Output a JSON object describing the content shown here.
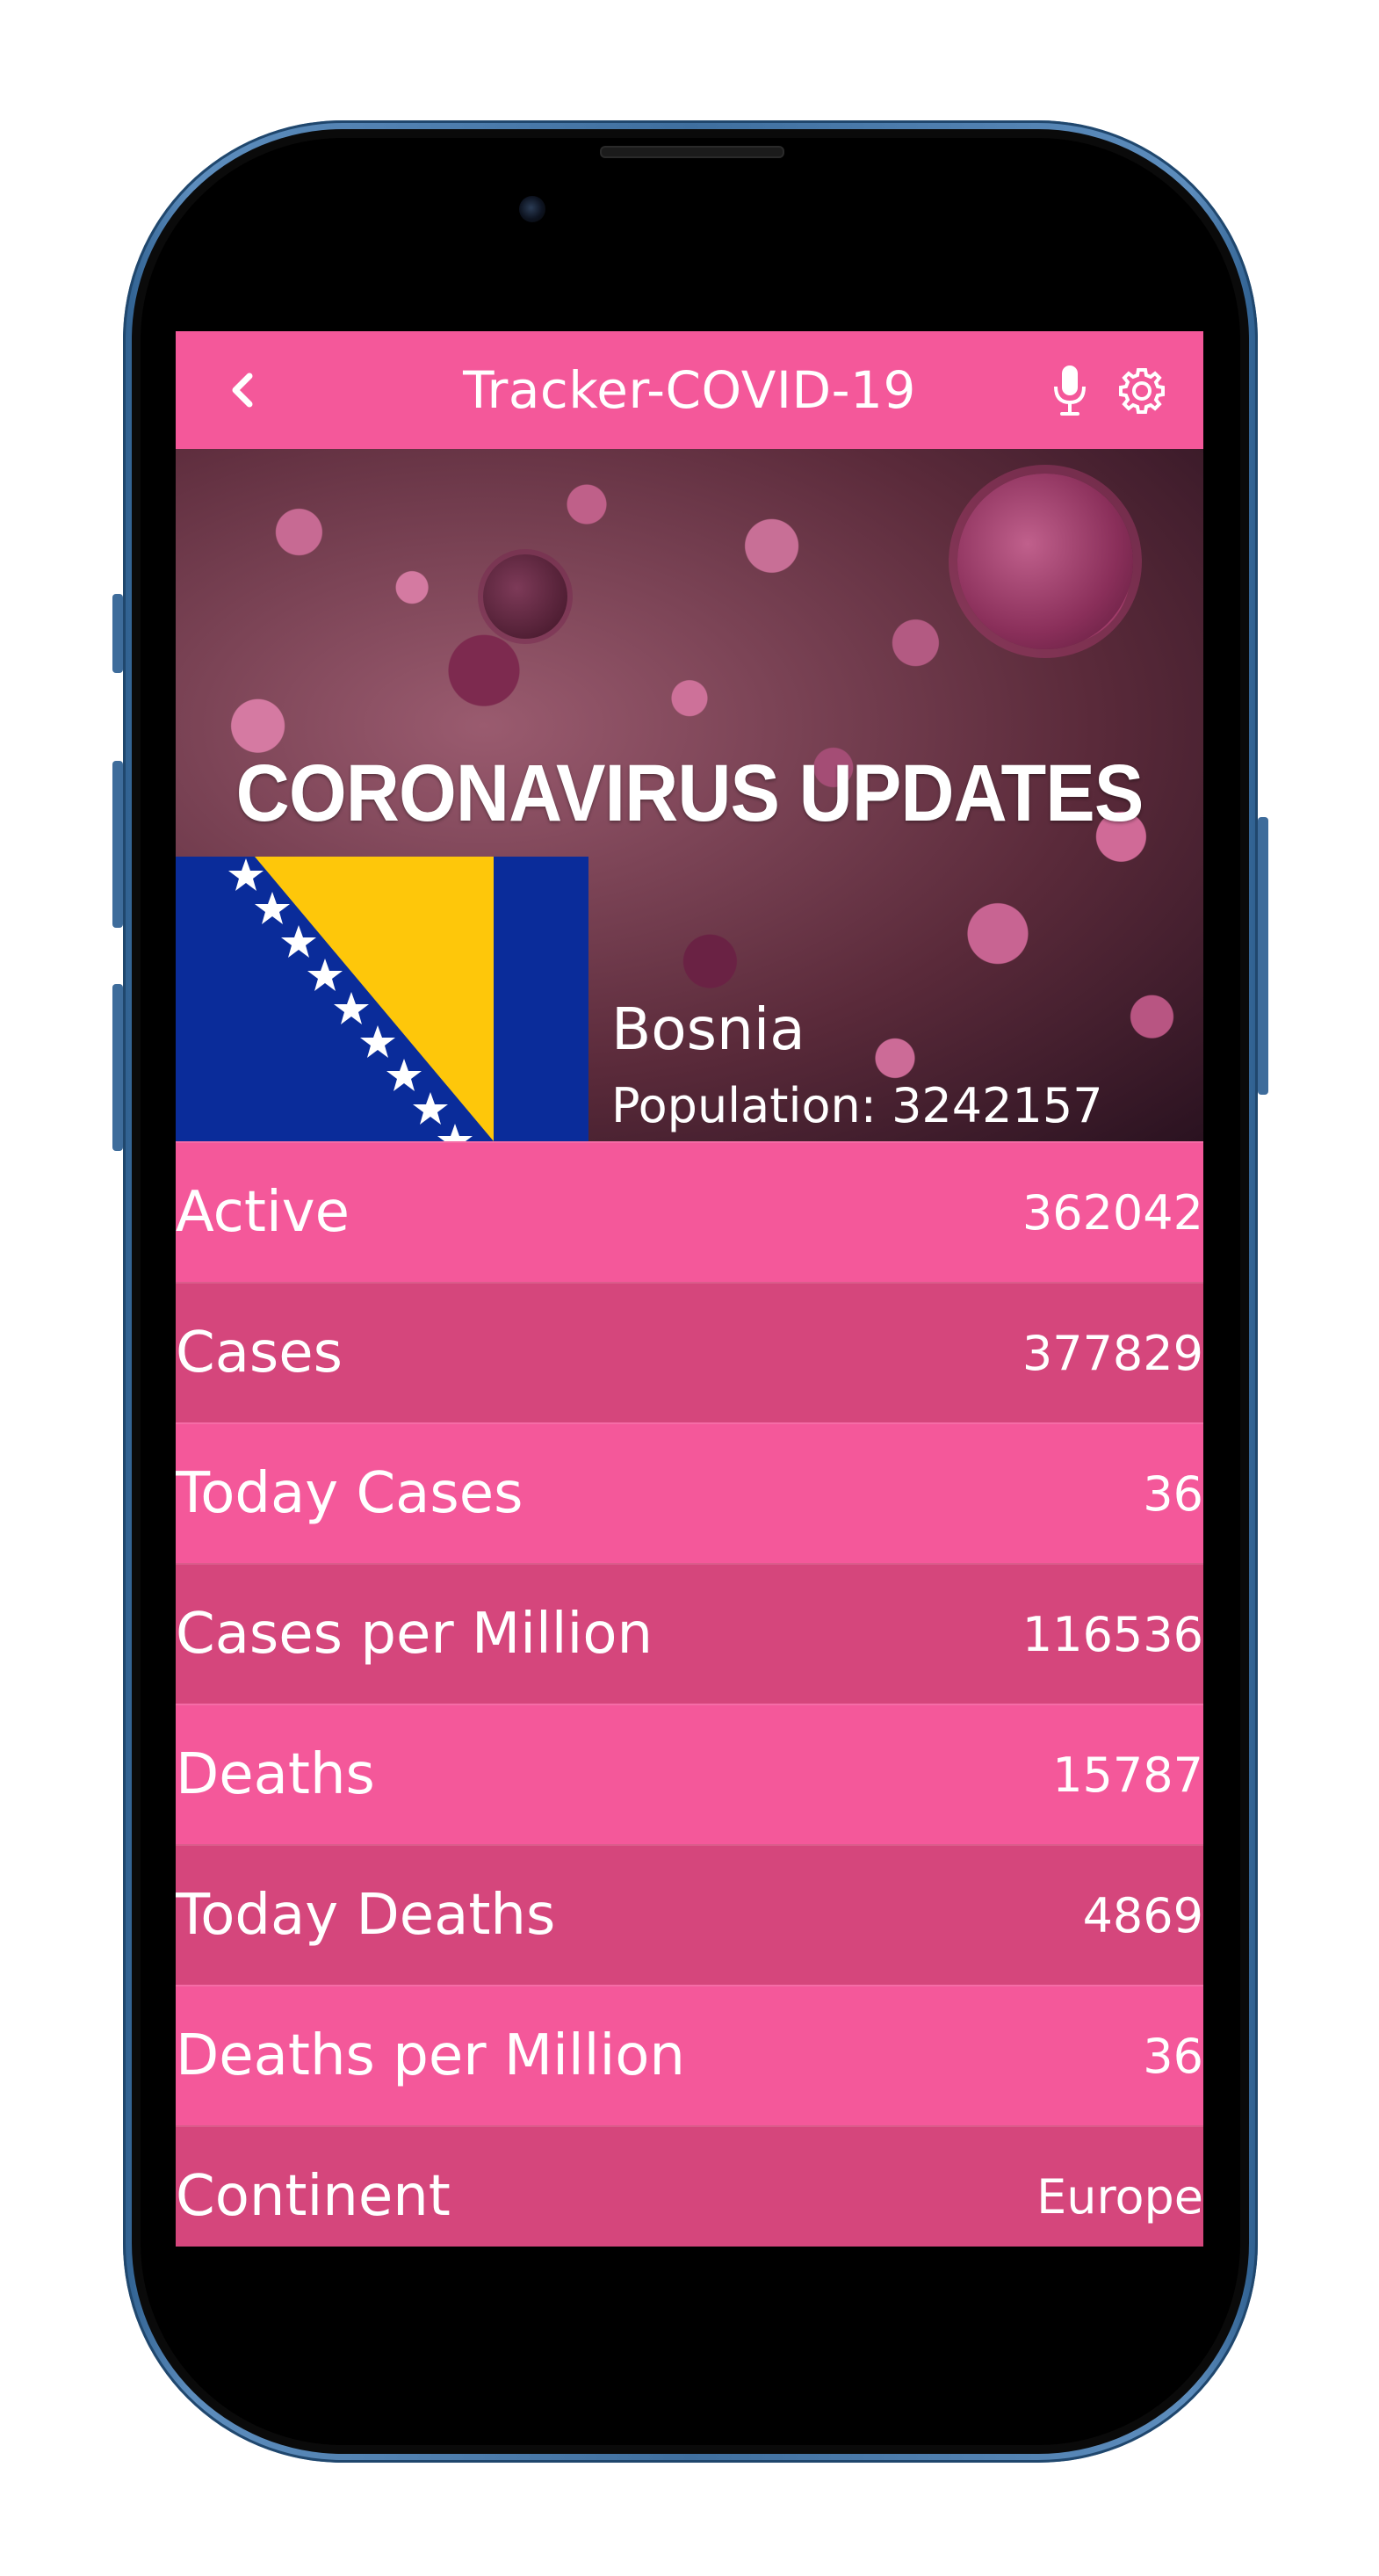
{
  "app": {
    "title": "Tracker-COVID-19"
  },
  "banner": {
    "heading": "CORONAVIRUS UPDATES",
    "country": "Bosnia",
    "population_text": "Population: 3242157"
  },
  "stats": [
    {
      "label": "Active",
      "value": "362042"
    },
    {
      "label": "Cases",
      "value": "377829"
    },
    {
      "label": "Today Cases",
      "value": "36"
    },
    {
      "label": "Cases per Million",
      "value": "116536"
    },
    {
      "label": "Deaths",
      "value": "15787"
    },
    {
      "label": "Today Deaths",
      "value": "4869"
    },
    {
      "label": "Deaths per Million",
      "value": "36"
    },
    {
      "label": "Continent",
      "value": "Europe"
    }
  ],
  "icons": {
    "back": "chevron-left-icon",
    "mic": "microphone-icon",
    "settings": "gear-icon"
  },
  "colors": {
    "accent": "#f4589a",
    "row_alt": "#d5467c",
    "flag_blue": "#0a2c9a",
    "flag_yellow": "#fec70a"
  }
}
